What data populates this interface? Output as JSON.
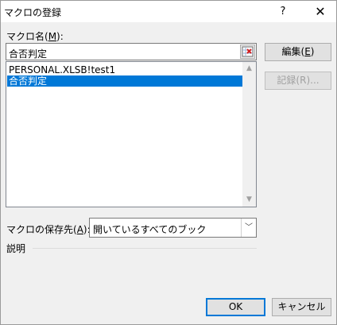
{
  "window": {
    "title": "マクロの登録",
    "help_label": "?",
    "close_label": "✕"
  },
  "macro_name": {
    "label_prefix": "マクロ名(",
    "label_key": "M",
    "label_suffix": "):",
    "value": "合否判定"
  },
  "macro_list": {
    "items": [
      {
        "label": "PERSONAL.XLSB!test1",
        "selected": false
      },
      {
        "label": "合否判定",
        "selected": true
      }
    ]
  },
  "buttons": {
    "edit": {
      "prefix": "編集(",
      "key": "E",
      "suffix": ")"
    },
    "record": {
      "label": "記録(R)...",
      "disabled": true
    },
    "ok": "OK",
    "cancel": "キャンセル"
  },
  "save_location": {
    "label_prefix": "マクロの保存先(",
    "label_key": "A",
    "label_suffix": "):",
    "selected": "開いているすべてのブック"
  },
  "description": {
    "label": "説明"
  }
}
